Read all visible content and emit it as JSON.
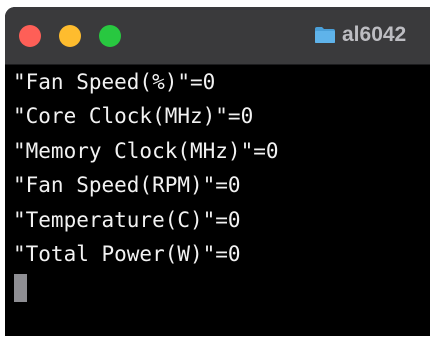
{
  "window": {
    "title": "al6042",
    "traffic_lights": {
      "close_color": "#fe5f57",
      "minimize_color": "#febc2e",
      "zoom_color": "#28c840"
    },
    "icon": "folder-icon"
  },
  "terminal": {
    "lines": [
      "\"Fan Speed(%)\"=0",
      "\"Core Clock(MHz)\"=0",
      "\"Memory Clock(MHz)\"=0",
      "\"Fan Speed(RPM)\"=0",
      "\"Temperature(C)\"=0",
      "\"Total Power(W)\"=0"
    ],
    "background_color": "#000000",
    "text_color": "#f2f2f2",
    "cursor_color": "#8e8e93"
  }
}
